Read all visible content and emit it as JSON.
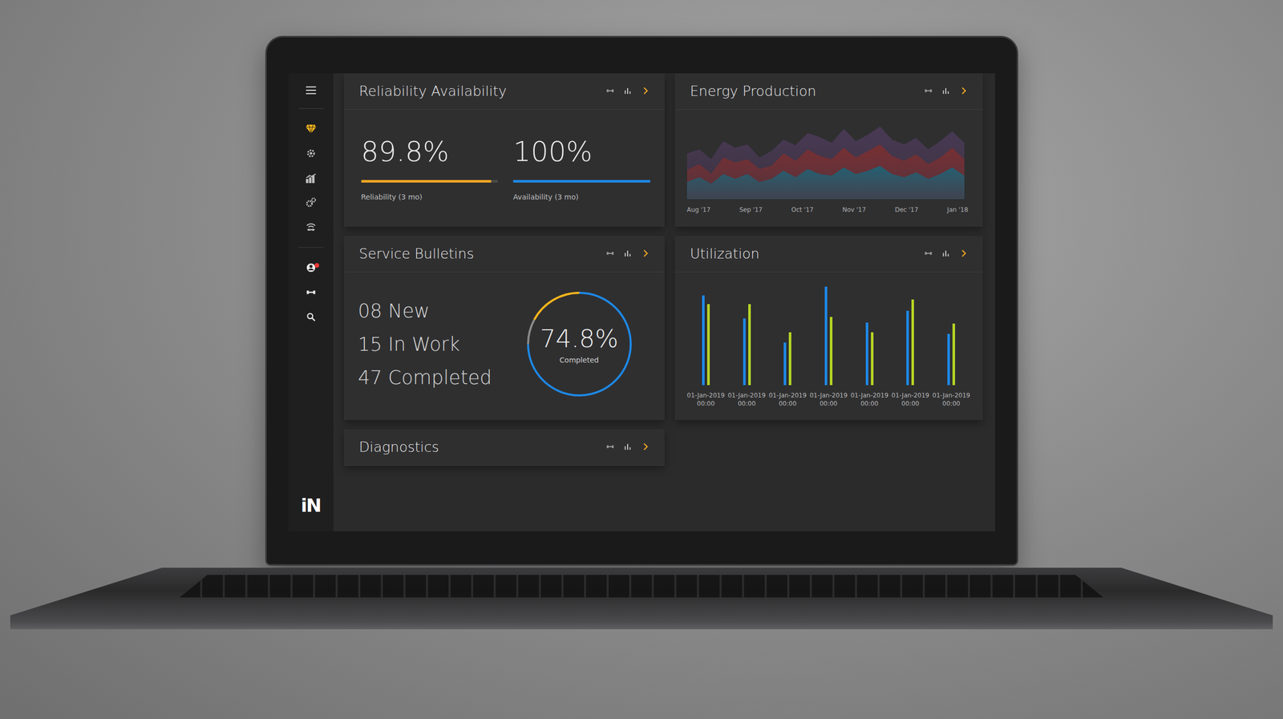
{
  "sidebar": {
    "items": [
      {
        "selected": true
      },
      {
        "selected": false
      },
      {
        "selected": false
      },
      {
        "selected": false
      },
      {
        "selected": false
      }
    ],
    "tools": [
      {
        "badge": true
      },
      {
        "badge": false
      },
      {
        "badge": false
      }
    ],
    "logo": "iN"
  },
  "reliability": {
    "title": "Reliability Availability",
    "metrics": [
      {
        "value": "89.8%",
        "label": "Reliability (3 mo)",
        "level": 0.95,
        "color": "#f5a623"
      },
      {
        "value": "100%",
        "label": "Availability (3 mo)",
        "level": 1,
        "color": "#1e88e5"
      }
    ]
  },
  "energy": {
    "title": "Energy Production",
    "x_labels": [
      "Aug '17",
      "Sep '17",
      "Oct '17",
      "Nov '17",
      "Dec '17",
      "Jan '18"
    ],
    "series": [
      {
        "color": "#4b3a57",
        "values": [
          55,
          60,
          48,
          70,
          62,
          66,
          50,
          58,
          72,
          65,
          80,
          75,
          68,
          85,
          70,
          78,
          88,
          72,
          66,
          74,
          60,
          70,
          82,
          68
        ]
      },
      {
        "color": "#7a2f30",
        "values": [
          35,
          42,
          30,
          50,
          44,
          48,
          36,
          40,
          55,
          46,
          60,
          52,
          48,
          62,
          50,
          58,
          66,
          52,
          46,
          54,
          42,
          50,
          62,
          48
        ]
      },
      {
        "color": "#1f6275",
        "values": [
          20,
          26,
          18,
          30,
          24,
          30,
          20,
          24,
          34,
          26,
          36,
          30,
          28,
          38,
          30,
          34,
          40,
          30,
          26,
          32,
          24,
          30,
          38,
          28
        ]
      }
    ]
  },
  "bulletins": {
    "title": "Service Bulletins",
    "stats": [
      "08 New",
      "15 In Work",
      "47 Completed"
    ],
    "donut": {
      "value": "74.8%",
      "label": "Completed",
      "segments": [
        {
          "level": 0.748,
          "color": "#1e88e5"
        },
        {
          "level": 0.08,
          "color": "#8a8a8a"
        },
        {
          "level": 0.172,
          "color": "#f5b51c"
        }
      ]
    }
  },
  "utilization": {
    "title": "Utilization",
    "series": [
      {
        "color": "#1e88e5",
        "values": [
          105,
          78,
          50,
          115,
          73,
          87,
          60
        ]
      },
      {
        "color": "#b5d424",
        "values": [
          95,
          95,
          62,
          80,
          62,
          100,
          72
        ]
      }
    ],
    "x_labels": [
      [
        "01-Jan-2019",
        "00:00"
      ],
      [
        "01-Jan-2019",
        "00:00"
      ],
      [
        "01-Jan-2019",
        "00:00"
      ],
      [
        "01-Jan-2019",
        "00:00"
      ],
      [
        "01-Jan-2019",
        "00:00"
      ],
      [
        "01-Jan-2019",
        "00:00"
      ],
      [
        "01-Jan-2019",
        "00:00"
      ]
    ]
  },
  "diagnostics": {
    "title": "Diagnostics"
  }
}
